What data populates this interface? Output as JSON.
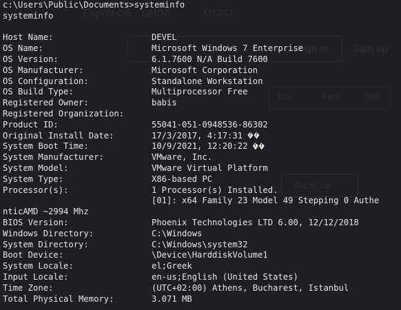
{
  "background_ghost": {
    "tabs": [
      "Exploit-DB",
      "GHDB",
      "MSFU"
    ],
    "auth": [
      "Sign in",
      "Sign up"
    ],
    "repo_stats": [
      "1.5k",
      "Fork",
      "368"
    ],
    "goto_file": "Go to file"
  },
  "prompt": {
    "path": "c:\\Users\\Public\\Documents>systeminfo",
    "echo": "systeminfo"
  },
  "info": {
    "host_name": {
      "key": "Host Name:",
      "value": "DEVEL"
    },
    "os_name": {
      "key": "OS Name:",
      "value": "Microsoft Windows 7 Enterprise"
    },
    "os_version": {
      "key": "OS Version:",
      "value": "6.1.7600 N/A Build 7600"
    },
    "os_manufacturer": {
      "key": "OS Manufacturer:",
      "value": "Microsoft Corporation"
    },
    "os_configuration": {
      "key": "OS Configuration:",
      "value": "Standalone Workstation"
    },
    "os_build_type": {
      "key": "OS Build Type:",
      "value": "Multiprocessor Free"
    },
    "registered_owner": {
      "key": "Registered Owner:",
      "value": "babis"
    },
    "registered_organization": {
      "key": "Registered Organization:",
      "value": ""
    },
    "product_id": {
      "key": "Product ID:",
      "value": "55041-051-0948536-86302"
    },
    "original_install_date": {
      "key": "Original Install Date:",
      "value": "17/3/2017, 4:17:31 "
    },
    "system_boot_time": {
      "key": "System Boot Time:",
      "value": "10/9/2021, 12:20:22 "
    },
    "system_manufacturer": {
      "key": "System Manufacturer:",
      "value": "VMware, Inc."
    },
    "system_model": {
      "key": "System Model:",
      "value": "VMware Virtual Platform"
    },
    "system_type": {
      "key": "System Type:",
      "value": "X86-based PC"
    },
    "processors": {
      "key": "Processor(s):",
      "value": "1 Processor(s) Installed."
    },
    "processor_line": "[01]: x64 Family 23 Model 49 Stepping 0 Authe",
    "processor_wrap": "nticAMD ~2994 Mhz",
    "bios_version": {
      "key": "BIOS Version:",
      "value": "Phoenix Technologies LTD 6.00, 12/12/2018"
    },
    "windows_directory": {
      "key": "Windows Directory:",
      "value": "C:\\Windows"
    },
    "system_directory": {
      "key": "System Directory:",
      "value": "C:\\Windows\\system32"
    },
    "boot_device": {
      "key": "Boot Device:",
      "value": "\\Device\\HarddiskVolume1"
    },
    "system_locale": {
      "key": "System Locale:",
      "value": "el;Greek"
    },
    "input_locale": {
      "key": "Input Locale:",
      "value": "en-us;English (United States)"
    },
    "time_zone": {
      "key": "Time Zone:",
      "value": "(UTC+02:00) Athens, Bucharest, Istanbul"
    },
    "total_physical_memory": {
      "key": "Total Physical Memory:",
      "value": "3.071 MB"
    }
  },
  "colors": {
    "background": "#1f1f23",
    "text": "#e6e6e6"
  },
  "icons": {
    "replacement_char": "replacement-char-icon"
  }
}
